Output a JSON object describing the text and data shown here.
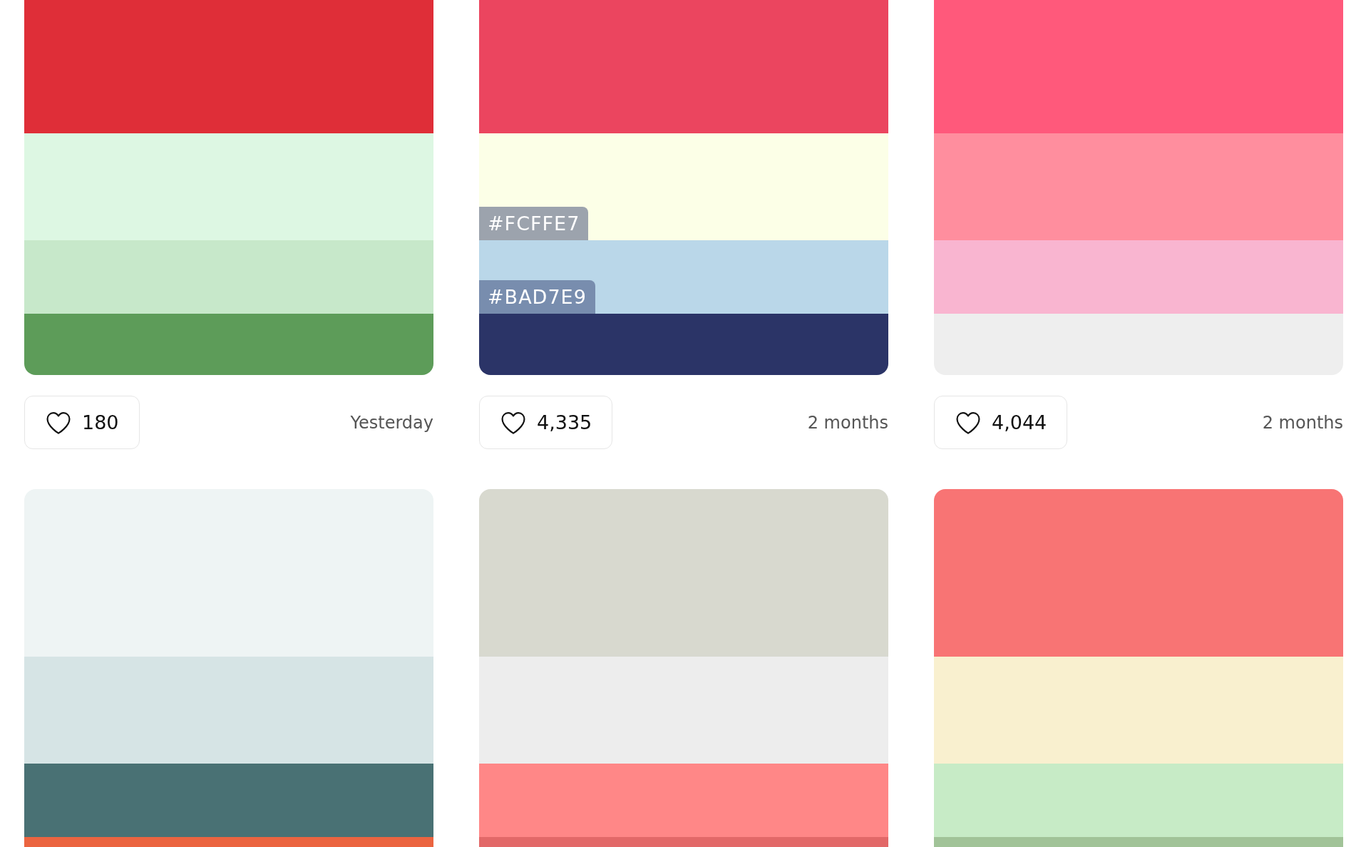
{
  "palettes": [
    {
      "colors": [
        {
          "color": "#df2e38"
        },
        {
          "color": "#ddf7e3"
        },
        {
          "color": "#c7e8ca"
        },
        {
          "color": "#5d9c59"
        }
      ],
      "likes": "180",
      "time": "Yesterday"
    },
    {
      "colors": [
        {
          "color": "#eb455f"
        },
        {
          "color": "#fcffe7",
          "label": "#FCFFE7"
        },
        {
          "color": "#bad7e9",
          "label": "#BAD7E9"
        },
        {
          "color": "#2b3467"
        }
      ],
      "likes": "4,335",
      "time": "2 months"
    },
    {
      "colors": [
        {
          "color": "#ff597b"
        },
        {
          "color": "#ff8e9e"
        },
        {
          "color": "#f9b5d0"
        },
        {
          "color": "#eeeeee"
        }
      ],
      "likes": "4,044",
      "time": "2 months"
    },
    {
      "colors": [
        {
          "color": "#eef4f4"
        },
        {
          "color": "#d6e4e5"
        },
        {
          "color": "#497174"
        },
        {
          "color": "#eb6440"
        }
      ]
    },
    {
      "colors": [
        {
          "color": "#d8d9cf"
        },
        {
          "color": "#ededed"
        },
        {
          "color": "#ff8787"
        },
        {
          "color": "#e26868"
        }
      ]
    },
    {
      "colors": [
        {
          "color": "#f87474"
        },
        {
          "color": "#f9f0cf"
        },
        {
          "color": "#c7ebc6"
        },
        {
          "color": "#a1c398"
        }
      ]
    }
  ]
}
